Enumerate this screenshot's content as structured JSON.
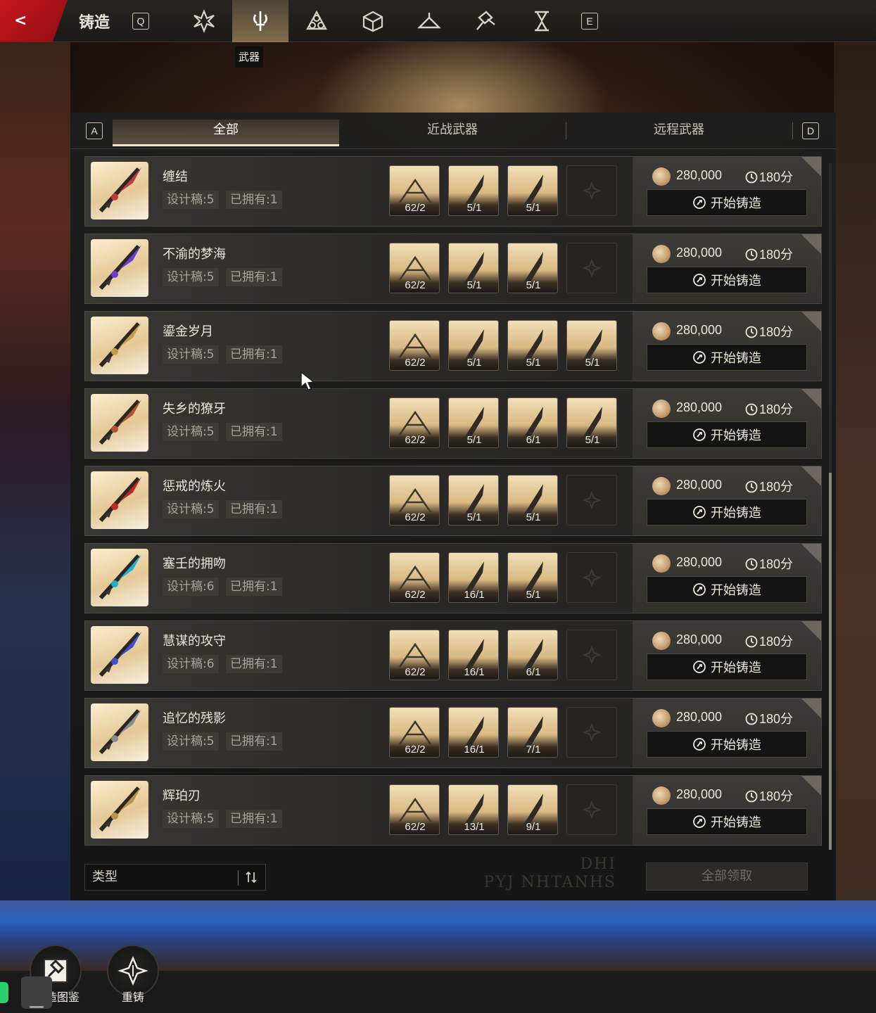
{
  "topbar": {
    "logo_glyph": "<",
    "title": "铸造",
    "key_left": "Q",
    "key_right": "E",
    "tabs": [
      {
        "icon": "shuriken-icon",
        "active": false
      },
      {
        "icon": "weapon-icon",
        "active": true
      },
      {
        "icon": "triquetra-icon",
        "active": false
      },
      {
        "icon": "cube-icon",
        "active": false
      },
      {
        "icon": "hanger-icon",
        "active": false
      },
      {
        "icon": "hammer-icon",
        "active": false
      },
      {
        "icon": "hourglass-icon",
        "active": false
      }
    ],
    "active_tab_label": "武器"
  },
  "category_tabs": {
    "key_left": "A",
    "key_right": "D",
    "items": [
      {
        "label": "全部",
        "active": true
      },
      {
        "label": "近战武器",
        "active": false
      },
      {
        "label": "远程武器",
        "active": false
      }
    ]
  },
  "forge_labels": {
    "cost": "280,000",
    "time": "180分",
    "button": "开始铸造"
  },
  "weapons": [
    {
      "name": "缠结",
      "design": "设计稿:5",
      "owned": "已拥有:1",
      "materials": [
        "62/2",
        "5/1",
        "5/1"
      ],
      "accent": "#c23a3a"
    },
    {
      "name": "不渝的梦海",
      "design": "设计稿:5",
      "owned": "已拥有:1",
      "materials": [
        "62/2",
        "5/1",
        "5/1"
      ],
      "accent": "#6b3bd6"
    },
    {
      "name": "鎏金岁月",
      "design": "设计稿:5",
      "owned": "已拥有:1",
      "materials": [
        "62/2",
        "5/1",
        "5/1",
        "5/1"
      ],
      "accent": "#c99a48"
    },
    {
      "name": "失乡的獠牙",
      "design": "设计稿:5",
      "owned": "已拥有:1",
      "materials": [
        "62/2",
        "5/1",
        "6/1",
        "5/1"
      ],
      "accent": "#b4532a"
    },
    {
      "name": "惩戒的炼火",
      "design": "设计稿:5",
      "owned": "已拥有:1",
      "materials": [
        "62/2",
        "5/1",
        "5/1"
      ],
      "accent": "#c0271f"
    },
    {
      "name": "塞壬的拥吻",
      "design": "设计稿:6",
      "owned": "已拥有:1",
      "materials": [
        "62/2",
        "16/1",
        "5/1"
      ],
      "accent": "#1db2c7"
    },
    {
      "name": "慧谋的攻守",
      "design": "设计稿:6",
      "owned": "已拥有:1",
      "materials": [
        "62/2",
        "16/1",
        "6/1"
      ],
      "accent": "#3e4fd0"
    },
    {
      "name": "追忆的残影",
      "design": "设计稿:5",
      "owned": "已拥有:1",
      "materials": [
        "62/2",
        "16/1",
        "7/1"
      ],
      "accent": "#8a8a8a"
    },
    {
      "name": "辉珀刃",
      "design": "设计稿:5",
      "owned": "已拥有:1",
      "materials": [
        "62/2",
        "13/1",
        "9/1"
      ],
      "accent": "#b6924a"
    }
  ],
  "footer": {
    "type_label": "类型",
    "emblem_line1": "DHI",
    "emblem_line2": "PYJ NHTANHS",
    "claim_all": "全部领取"
  },
  "bottom_buttons": {
    "codex": "造图鉴",
    "reforge": "重铸"
  },
  "colors": {
    "brand_red": "#c8161c",
    "accent_gold": "#f2e6c9"
  }
}
